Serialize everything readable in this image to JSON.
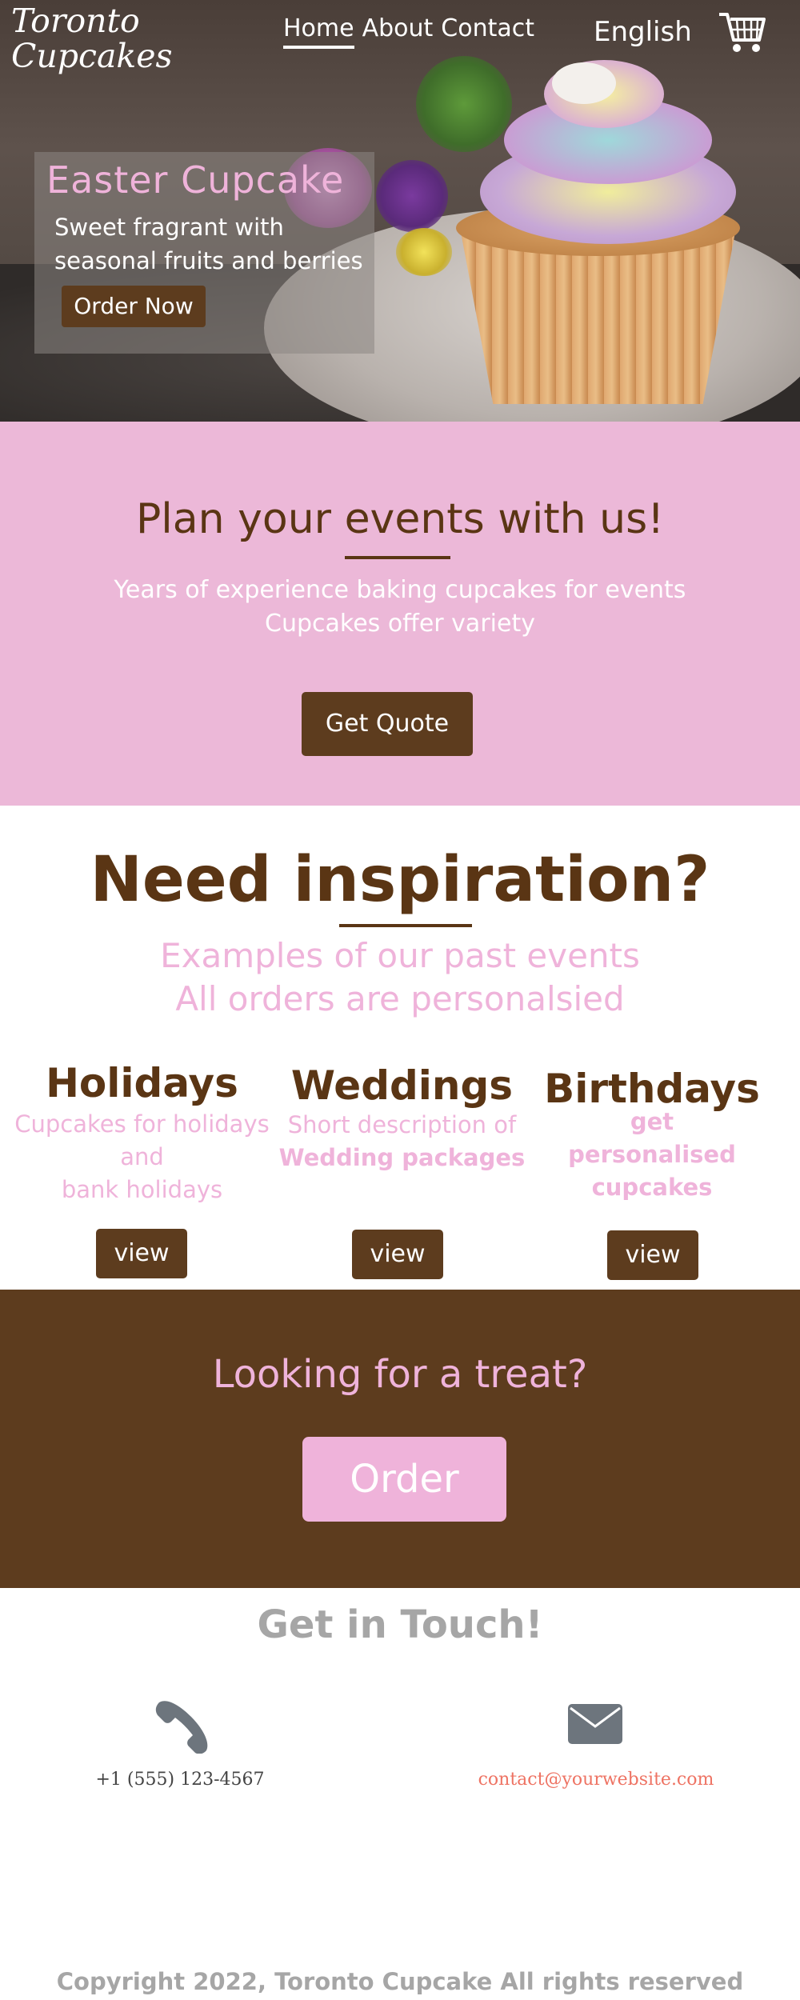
{
  "header": {
    "logo": "Toronto Cupcakes",
    "nav": [
      {
        "label": "Home",
        "active": true
      },
      {
        "label": "About",
        "active": false
      },
      {
        "label": "Contact",
        "active": false
      }
    ],
    "language": "English",
    "cart_icon": "shopping-cart-icon"
  },
  "hero": {
    "title": "Easter Cupcake",
    "description": "Sweet fragrant with seasonal fruits and berries",
    "button": "Order Now"
  },
  "events": {
    "title": "Plan your events with us!",
    "lines": [
      "Years of experience baking cupcakes for events",
      "Cupcakes offer variety"
    ],
    "button": "Get Quote"
  },
  "inspiration": {
    "title": "Need inspiration?",
    "lines": [
      "Examples of our past events",
      "All orders are personalsied"
    ],
    "categories": [
      {
        "title": "Holidays",
        "desc": [
          "Cupcakes for holidays",
          "and",
          "bank holidays"
        ],
        "button": "view"
      },
      {
        "title": "Weddings",
        "desc": [
          "Short description of",
          "Wedding packages"
        ],
        "button": "view"
      },
      {
        "title": "Birthdays",
        "desc": [
          "get",
          "personalised",
          "cupcakes"
        ],
        "button": "view"
      }
    ]
  },
  "treat": {
    "title": "Looking for a treat?",
    "button": "Order"
  },
  "contact": {
    "title": "Get in Touch!",
    "phone": "+1 (555) 123-4567",
    "email": "contact@yourwebsite.com",
    "phone_icon": "phone-icon",
    "email_icon": "envelope-icon"
  },
  "footer": {
    "copyright": "Copyright 2022, Toronto Cupcake All rights reserved"
  },
  "colors": {
    "brown": "#5d3c1e",
    "pink": "#ecb8d8",
    "light_pink": "#efb3da",
    "gray_text": "#a6a6a6",
    "email_link": "#ee7363"
  }
}
